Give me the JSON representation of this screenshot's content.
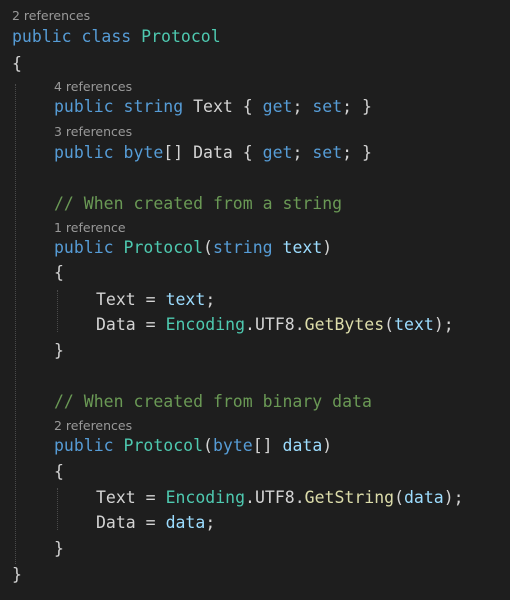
{
  "editor": {
    "colors": {
      "background": "#1e1e1e",
      "keyword": "#569cd6",
      "type": "#4ec9b0",
      "parameter": "#9cdcfe",
      "method": "#dcdcaa",
      "comment": "#6a9955",
      "codelens": "#999999"
    },
    "class_refs": "2 references",
    "kw_public": "public",
    "kw_class": "class",
    "kw_string": "string",
    "kw_byte": "byte",
    "kw_get": "get",
    "kw_set": "set",
    "class_name": "Protocol",
    "open_brace": "{",
    "close_brace": "}",
    "text_prop": {
      "refs": "4 references",
      "name": "Text",
      "accessors_tail": "; }"
    },
    "data_prop": {
      "refs": "3 references",
      "array": "[]",
      "name": "Data"
    },
    "ctor_string": {
      "comment": "// When created from a string",
      "refs": "1 reference",
      "param": "text",
      "line1": {
        "target": "Text",
        "op": " = ",
        "value": "text",
        "end": ";"
      },
      "line2": {
        "target": "Data",
        "op": " = ",
        "encoding": "Encoding",
        "dot_utf8": ".UTF8.",
        "method": "GetBytes",
        "arg": "text",
        "end": ");"
      }
    },
    "ctor_bytes": {
      "comment": "// When created from binary data",
      "refs": "2 references",
      "param": "data",
      "line1": {
        "target": "Text",
        "op": " = ",
        "encoding": "Encoding",
        "dot_utf8": ".UTF8.",
        "method": "GetString",
        "arg": "data",
        "end": ");"
      },
      "line2": {
        "target": "Data",
        "op": " = ",
        "value": "data",
        "end": ";"
      }
    }
  }
}
